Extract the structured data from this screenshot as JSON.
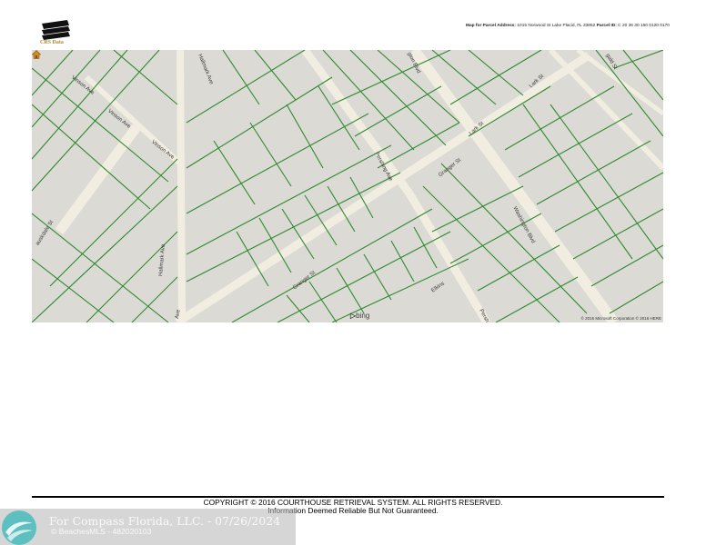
{
  "header": {
    "logo_text": "CRS Data",
    "map_for_label": "Map for Parcel Address:",
    "address": "1015 Norwood St Lake Placid, FL 33852",
    "parcel_label": "Parcel ID:",
    "parcel_id": "C 20 36 30 150 0120 0170"
  },
  "map": {
    "streets": {
      "vinson_ave_1": "Vinson Ave",
      "vinson_ave_2": "Vinson Ave",
      "vinson_ave_3": "Vinson Ave",
      "hallmark_ave_top": "Hallmark Ave",
      "hallmark_ave_bottom": "Hallmark Ave",
      "hallmark_ave_edge": "Ave",
      "washington_blvd_top": "gton Blvd",
      "washington_blvd": "Washington Blvd",
      "lark_st_1": "Lark St",
      "lark_st_2": "Lark St",
      "granger_st_1": "Granger St",
      "granger_st_2": "Granger St",
      "pershing_ave": "Pershing Ave",
      "pershing_ave_bottom": "Persh",
      "elkins": "Elkins",
      "auskdale_st": "auskdale St",
      "top_right": "gald St"
    },
    "bing_label": "bing",
    "attribution": "© 2016 Microsoft Corporation © 2016 HERE",
    "colors": {
      "background": "#dcdad5",
      "parcel_lines": "#2c8a2c",
      "roads": "#f1ede1",
      "marker": "#d88a1a"
    }
  },
  "footer": {
    "copyright": "COPYRIGHT © 2016 COURTHOUSE RETRIEVAL SYSTEM. ALL RIGHTS RESERVED.",
    "disclaimer": "Information Deemed Reliable But Not Guaranteed."
  },
  "watermark": {
    "line1": "For Compass Florida, LLC. - 07/26/2024",
    "line2": "© BeachesMLS - 482020103"
  }
}
